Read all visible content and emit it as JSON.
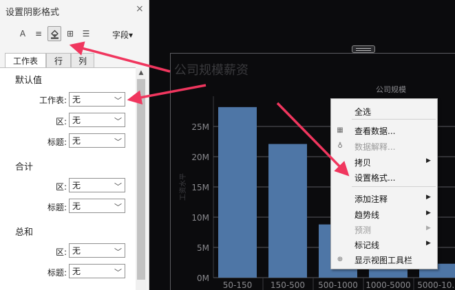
{
  "pane": {
    "title": "设置阴影格式",
    "close": "×",
    "toolbar": {
      "font_glyph": "A",
      "align_glyph": "≡",
      "shading_glyph": "◈",
      "borders_glyph": "⊞",
      "lines_glyph": "☰",
      "field_menu": "字段▾"
    },
    "tabs": [
      "工作表",
      "行",
      "列"
    ],
    "active_tab": "工作表",
    "sections": {
      "default": {
        "title": "默认值",
        "worksheet_label": "工作表:",
        "worksheet_value": "无",
        "area_label": "区:",
        "area_value": "无",
        "header_label": "标题:",
        "header_value": "无"
      },
      "total": {
        "title": "合计",
        "area_label": "区:",
        "area_value": "无",
        "header_label": "标题:",
        "header_value": "无"
      },
      "grand_total": {
        "title": "总和",
        "area_label": "区:",
        "area_value": "无",
        "header_label": "标题:",
        "header_value": "无"
      }
    }
  },
  "view": {
    "title": "公司规模薪资"
  },
  "chart_data": {
    "type": "bar",
    "header_label": "公司规模",
    "ylabel": "工资水平",
    "categories": [
      "50-150",
      "150-500",
      "500-1000",
      "1000-5000",
      "5000-10..."
    ],
    "values": [
      28200000,
      22100000,
      8800000,
      3500000,
      2300000
    ],
    "ylim": [
      0,
      30000000
    ],
    "yticks": [
      0,
      5000000,
      10000000,
      15000000,
      20000000,
      25000000
    ],
    "ytick_labels": [
      "0M",
      "5M",
      "10M",
      "15M",
      "20M",
      "25M"
    ],
    "grid": true,
    "bar_color": "#4e76a6",
    "grid_color": "#5a5a5e",
    "label_color": "#8a8a8e"
  },
  "context_menu": {
    "items": [
      {
        "label": "全选",
        "icon": "",
        "submenu": false,
        "disabled": false
      },
      {
        "label": "查看数据...",
        "icon": "data-grid-icon",
        "submenu": false,
        "disabled": false
      },
      {
        "label": "数据解释...",
        "icon": "lightbulb-icon",
        "submenu": false,
        "disabled": true
      },
      {
        "label": "拷贝",
        "icon": "",
        "submenu": true,
        "disabled": false
      },
      {
        "label": "设置格式...",
        "icon": "",
        "submenu": false,
        "disabled": false
      },
      {
        "label": "添加注释",
        "icon": "",
        "submenu": true,
        "disabled": false
      },
      {
        "label": "趋势线",
        "icon": "",
        "submenu": true,
        "disabled": false
      },
      {
        "label": "预测",
        "icon": "",
        "submenu": true,
        "disabled": true
      },
      {
        "label": "标记线",
        "icon": "",
        "submenu": true,
        "disabled": false
      },
      {
        "label": "显示视图工具栏",
        "icon": "zoom-icon",
        "submenu": false,
        "disabled": false
      }
    ]
  },
  "colors": {
    "arrow": "#f0365e",
    "canvas": "#0b0b0d",
    "pane": "#f4f4f4"
  }
}
